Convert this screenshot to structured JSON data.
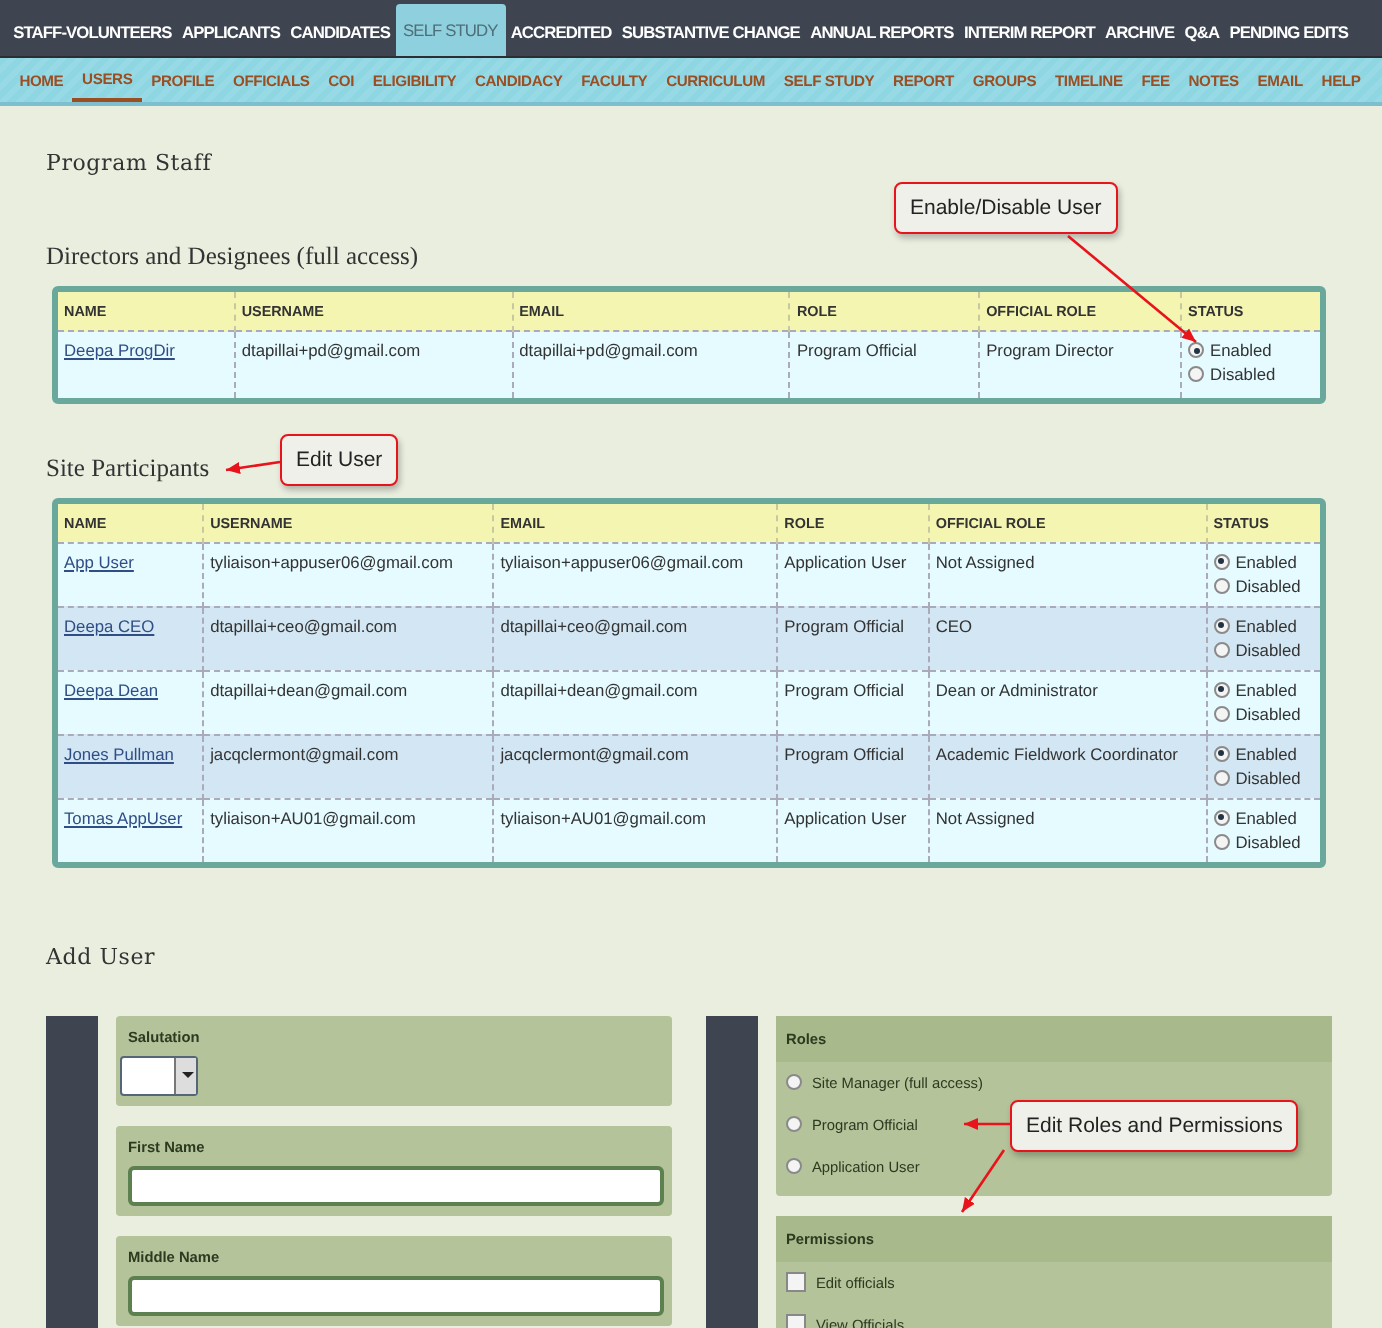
{
  "top_nav": [
    {
      "label": "STAFF-VOLUNTEERS",
      "selected": false
    },
    {
      "label": "APPLICANTS",
      "selected": false
    },
    {
      "label": "CANDIDATES",
      "selected": false
    },
    {
      "label": "SELF STUDY",
      "selected": true
    },
    {
      "label": "ACCREDITED",
      "selected": false
    },
    {
      "label": "SUBSTANTIVE CHANGE",
      "selected": false
    },
    {
      "label": "ANNUAL REPORTS",
      "selected": false
    },
    {
      "label": "INTERIM REPORT",
      "selected": false
    },
    {
      "label": "ARCHIVE",
      "selected": false
    },
    {
      "label": "Q&A",
      "selected": false
    },
    {
      "label": "PENDING EDITS",
      "selected": false
    }
  ],
  "sub_nav": [
    {
      "label": "HOME",
      "selected": false
    },
    {
      "label": "USERS",
      "selected": true
    },
    {
      "label": "PROFILE",
      "selected": false
    },
    {
      "label": "OFFICIALS",
      "selected": false
    },
    {
      "label": "COI",
      "selected": false
    },
    {
      "label": "ELIGIBILITY",
      "selected": false
    },
    {
      "label": "CANDIDACY",
      "selected": false
    },
    {
      "label": "FACULTY",
      "selected": false
    },
    {
      "label": "CURRICULUM",
      "selected": false
    },
    {
      "label": "SELF STUDY",
      "selected": false
    },
    {
      "label": "REPORT",
      "selected": false
    },
    {
      "label": "GROUPS",
      "selected": false
    },
    {
      "label": "TIMELINE",
      "selected": false
    },
    {
      "label": "FEE",
      "selected": false
    },
    {
      "label": "NOTES",
      "selected": false
    },
    {
      "label": "EMAIL",
      "selected": false
    },
    {
      "label": "HELP",
      "selected": false
    }
  ],
  "page_title": "Program Staff",
  "tables": [
    {
      "title": "Directors and Designees (full access)",
      "columns": [
        "NAME",
        "USERNAME",
        "EMAIL",
        "ROLE",
        "OFFICIAL ROLE",
        "STATUS"
      ],
      "rows": [
        {
          "name": "Deepa ProgDir",
          "username": "dtapillai+pd@gmail.com",
          "email": "dtapillai+pd@gmail.com",
          "role": "Program Official",
          "official_role": "Program Director",
          "status": [
            {
              "label": "Enabled",
              "selected": true
            },
            {
              "label": "Disabled",
              "selected": false
            }
          ]
        }
      ]
    },
    {
      "title": "Site Participants",
      "columns": [
        "NAME",
        "USERNAME",
        "EMAIL",
        "ROLE",
        "OFFICIAL ROLE",
        "STATUS"
      ],
      "rows": [
        {
          "name": "App User",
          "username": "tyliaison+appuser06@gmail.com",
          "email": "tyliaison+appuser06@gmail.com",
          "role": "Application User",
          "official_role": "Not Assigned",
          "status": [
            {
              "label": "Enabled",
              "selected": true
            },
            {
              "label": "Disabled",
              "selected": false
            }
          ]
        },
        {
          "name": "Deepa CEO",
          "username": "dtapillai+ceo@gmail.com",
          "email": "dtapillai+ceo@gmail.com",
          "role": "Program Official",
          "official_role": "CEO",
          "status": [
            {
              "label": "Enabled",
              "selected": true
            },
            {
              "label": "Disabled",
              "selected": false
            }
          ]
        },
        {
          "name": "Deepa Dean",
          "username": "dtapillai+dean@gmail.com",
          "email": "dtapillai+dean@gmail.com",
          "role": "Program Official",
          "official_role": "Dean or Administrator",
          "status": [
            {
              "label": "Enabled",
              "selected": true
            },
            {
              "label": "Disabled",
              "selected": false
            }
          ]
        },
        {
          "name": "Jones Pullman",
          "username": "jacqclermont@gmail.com",
          "email": "jacqclermont@gmail.com",
          "role": "Program Official",
          "official_role": "Academic Fieldwork Coordinator",
          "status": [
            {
              "label": "Enabled",
              "selected": true
            },
            {
              "label": "Disabled",
              "selected": false
            }
          ]
        },
        {
          "name": "Tomas AppUser",
          "username": "tyliaison+AU01@gmail.com",
          "email": "tyliaison+AU01@gmail.com",
          "role": "Application User",
          "official_role": "Not Assigned",
          "status": [
            {
              "label": "Enabled",
              "selected": true
            },
            {
              "label": "Disabled",
              "selected": false
            }
          ]
        }
      ]
    }
  ],
  "add_user": {
    "title": "Add User",
    "fields": [
      {
        "label": "Salutation",
        "kind": "select"
      },
      {
        "label": "First Name",
        "kind": "text"
      },
      {
        "label": "Middle Name",
        "kind": "text"
      }
    ],
    "roles": {
      "title": "Roles",
      "options": [
        {
          "label": "Site Manager (full access)",
          "selected": false
        },
        {
          "label": "Program Official",
          "selected": false
        },
        {
          "label": "Application User",
          "selected": false
        }
      ]
    },
    "permissions": {
      "title": "Permissions",
      "options": [
        {
          "label": "Edit officials",
          "checked": false
        },
        {
          "label": "View Officials",
          "checked": false
        }
      ]
    }
  },
  "annotations": [
    {
      "text": "Enable/Disable User"
    },
    {
      "text": "Edit User"
    },
    {
      "text": "Edit Roles and Permissions"
    }
  ]
}
